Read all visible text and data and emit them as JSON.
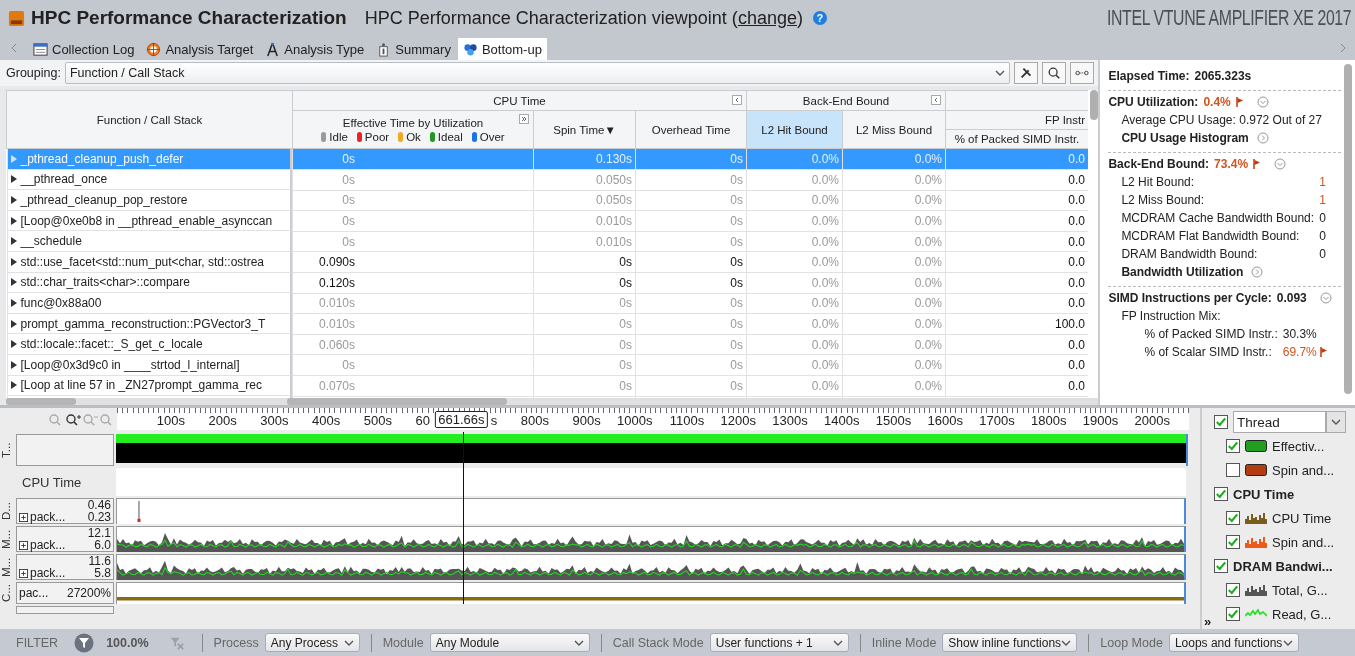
{
  "header": {
    "title": "HPC Performance Characterization",
    "viewpoint": "HPC Performance Characterization viewpoint (",
    "link": "change",
    "viewpoint_end": ")",
    "help": "?",
    "brand": "INTEL VTUNE AMPLIFIER XE 2017"
  },
  "tabs": [
    {
      "label": "Collection Log",
      "selected": false
    },
    {
      "label": "Analysis Target",
      "selected": false
    },
    {
      "label": "Analysis Type",
      "selected": false
    },
    {
      "label": "Summary",
      "selected": false
    },
    {
      "label": "Bottom-up",
      "selected": true
    }
  ],
  "grouping": {
    "label": "Grouping:",
    "value": "Function / Call Stack"
  },
  "table": {
    "name_column": "Function / Call Stack",
    "groups": [
      {
        "label": "CPU Time",
        "columns": [
          {
            "label": "Effective Time by Utilization",
            "kind": "time",
            "selected": false,
            "legend": [
              {
                "label": "Idle",
                "color": "#9a9a9a"
              },
              {
                "label": "Poor",
                "color": "#ee2222"
              },
              {
                "label": "Ok",
                "color": "#f5a623"
              },
              {
                "label": "Ideal",
                "color": "#1e9a1e"
              },
              {
                "label": "Over",
                "color": "#1a73e8"
              }
            ]
          },
          {
            "label": "Spin Time",
            "kind": "time",
            "selected": false,
            "sort_mark": "▼"
          },
          {
            "label": "Overhead Time",
            "kind": "time",
            "selected": false
          }
        ]
      },
      {
        "label": "Back-End Bound",
        "columns": [
          {
            "label": "L2 Hit Bound",
            "kind": "ratio",
            "selected": true
          },
          {
            "label": "L2 Miss Bound",
            "kind": "ratio",
            "selected": false
          }
        ]
      },
      {
        "columns": [
          {
            "super": "FP Instr",
            "label": "% of Packed SIMD Instr.",
            "kind": "plain",
            "selected": false
          }
        ]
      }
    ],
    "rows": [
      {
        "name": "_pthread_cleanup_push_defer",
        "selected": true,
        "hot": false,
        "values": [
          "0s",
          "0.130s",
          "0s",
          "0.0%",
          "0.0%",
          "0.0"
        ]
      },
      {
        "name": "__pthread_once",
        "selected": false,
        "hot": false,
        "values": [
          "0s",
          "0.050s",
          "0s",
          "0.0%",
          "0.0%",
          "0.0"
        ]
      },
      {
        "name": "_pthread_cleanup_pop_restore",
        "selected": false,
        "hot": false,
        "values": [
          "0s",
          "0.050s",
          "0s",
          "0.0%",
          "0.0%",
          "0.0"
        ]
      },
      {
        "name": "[Loop@0xe0b8 in __pthread_enable_asynccan",
        "selected": false,
        "hot": false,
        "values": [
          "0s",
          "0.010s",
          "0s",
          "0.0%",
          "0.0%",
          "0.0"
        ]
      },
      {
        "name": "__schedule",
        "selected": false,
        "hot": false,
        "values": [
          "0s",
          "0.010s",
          "0s",
          "0.0%",
          "0.0%",
          "0.0"
        ]
      },
      {
        "name": "std::use_facet<std::num_put<char, std::ostrea",
        "selected": false,
        "hot": true,
        "values": [
          "0.090s",
          "0s",
          "0s",
          "0.0%",
          "0.0%",
          "0.0"
        ]
      },
      {
        "name": "std::char_traits<char>::compare",
        "selected": false,
        "hot": true,
        "values": [
          "0.120s",
          "0s",
          "0s",
          "0.0%",
          "0.0%",
          "0.0"
        ]
      },
      {
        "name": "func@0x88a00",
        "selected": false,
        "hot": false,
        "values": [
          "0.010s",
          "0s",
          "0s",
          "0.0%",
          "0.0%",
          "0.0"
        ]
      },
      {
        "name": "prompt_gamma_reconstruction::PGVector3_T",
        "selected": false,
        "hot": false,
        "values": [
          "0.010s",
          "0s",
          "0s",
          "0.0%",
          "0.0%",
          "100.0"
        ]
      },
      {
        "name": "std::locale::facet::_S_get_c_locale",
        "selected": false,
        "hot": false,
        "values": [
          "0.060s",
          "0s",
          "0s",
          "0.0%",
          "0.0%",
          "0.0"
        ]
      },
      {
        "name": "[Loop@0x3d9c0 in ____strtod_l_internal]",
        "selected": false,
        "hot": false,
        "values": [
          "0s",
          "0s",
          "0s",
          "0.0%",
          "0.0%",
          "0.0"
        ]
      },
      {
        "name": "[Loop at line 57 in _ZN27prompt_gamma_rec",
        "selected": false,
        "hot": false,
        "values": [
          "0.070s",
          "0s",
          "0s",
          "0.0%",
          "0.0%",
          "0.0"
        ]
      }
    ]
  },
  "summary": {
    "elapsed": {
      "label": "Elapsed Time:",
      "value": "2065.323s"
    },
    "sections": [
      {
        "label": "CPU Utilization:",
        "value": "0.4%",
        "flagged": true,
        "items": [
          {
            "kind": "text",
            "label": "Average CPU Usage: 0.972 Out of 27"
          },
          {
            "kind": "link",
            "label": "CPU Usage Histogram"
          }
        ]
      },
      {
        "label": "Back-End Bound:",
        "value": "73.4%",
        "flagged": true,
        "items": [
          {
            "kind": "metric",
            "label": "L2 Hit Bound:",
            "value": "1",
            "alert": true
          },
          {
            "kind": "metric",
            "label": "L2 Miss Bound:",
            "value": "1",
            "alert": true
          },
          {
            "kind": "metric",
            "label": "MCDRAM Cache Bandwidth Bound:",
            "value": "0",
            "alert": false
          },
          {
            "kind": "metric",
            "label": "MCDRAM Flat Bandwidth Bound:",
            "value": "0",
            "alert": false
          },
          {
            "kind": "metric",
            "label": "DRAM Bandwidth Bound:",
            "value": "0",
            "alert": false
          },
          {
            "kind": "link",
            "label": "Bandwidth Utilization"
          }
        ]
      },
      {
        "label": "SIMD Instructions per Cycle:",
        "value": "0.093",
        "flagged": false,
        "items": [
          {
            "kind": "text",
            "label": "FP Instruction Mix:"
          },
          {
            "kind": "metric",
            "indent": true,
            "label": "% of Packed SIMD Instr.:",
            "value": "30.3%",
            "alert": false,
            "flagged": false
          },
          {
            "kind": "metric",
            "indent": true,
            "label": "% of Scalar SIMD Instr.:",
            "value": "69.7%",
            "alert": true,
            "flagged": true
          }
        ]
      }
    ]
  },
  "timeline": {
    "ticks": [
      "100s",
      "200s",
      "300s",
      "400s",
      "500s",
      "60",
      "s",
      "800s",
      "900s",
      "1000s",
      "1100s",
      "1200s",
      "1300s",
      "1400s",
      "1500s",
      "1600s",
      "1700s",
      "1800s",
      "1900s",
      "2000s"
    ],
    "cursor": "661.66s",
    "lanes": [
      {
        "kind": "thread",
        "label": "T..."
      },
      {
        "kind": "header",
        "label": "CPU Time"
      },
      {
        "kind": "spike",
        "label": "D...",
        "max": "0.46",
        "name": "pack...",
        "mid": "0.23"
      },
      {
        "kind": "noise",
        "label": "M...",
        "max": "12.1",
        "name": "pack...",
        "mid": "6.0"
      },
      {
        "kind": "noise",
        "label": "M...",
        "max": "11.6",
        "name": "pack...",
        "mid": "5.8"
      },
      {
        "kind": "flat",
        "label": "C...",
        "name": "pac...",
        "max": "27200%"
      }
    ],
    "legend": [
      {
        "kind": "select",
        "label": "Thread",
        "checked": true,
        "children": [
          {
            "label": "Effectiv...",
            "checked": true,
            "kind": "bar",
            "color": "#1f9e1f"
          },
          {
            "label": "Spin and...",
            "checked": false,
            "kind": "bar",
            "color": "#b23c12"
          }
        ]
      },
      {
        "kind": "group",
        "label": "CPU Time",
        "checked": true,
        "children": [
          {
            "label": "CPU Time",
            "checked": true,
            "kind": "histogram",
            "color": "#7a5c1e"
          },
          {
            "label": "Spin and...",
            "checked": true,
            "kind": "histogram",
            "color": "#ee5a1a"
          }
        ]
      },
      {
        "kind": "group",
        "label": "DRAM Bandwi...",
        "checked": true,
        "children": [
          {
            "label": "Total, G...",
            "checked": true,
            "kind": "histogram",
            "color": "#555555"
          },
          {
            "label": "Read, G...",
            "checked": true,
            "kind": "line",
            "color": "#22dd22"
          }
        ]
      }
    ],
    "more": "»"
  },
  "filter_bar": {
    "label": "FILTER",
    "percent": "100.0%",
    "controls": [
      {
        "label": "Process",
        "value": "Any Process"
      },
      {
        "label": "Module",
        "value": "Any Module"
      },
      {
        "label": "Call Stack Mode",
        "value": "User functions + 1"
      },
      {
        "label": "Inline Mode",
        "value": "Show inline functions"
      },
      {
        "label": "Loop Mode",
        "value": "Loops and functions"
      }
    ]
  }
}
